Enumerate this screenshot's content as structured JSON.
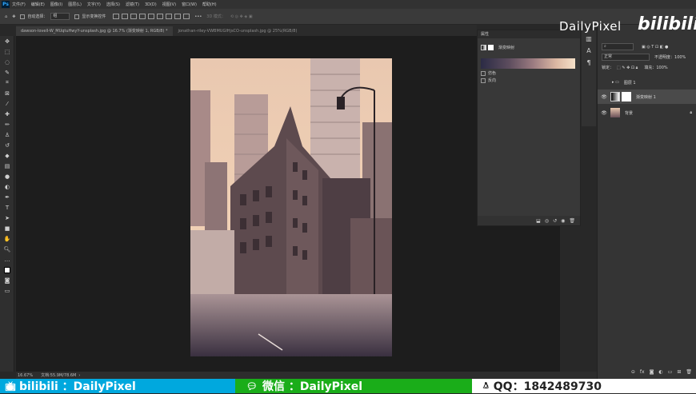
{
  "app": {
    "ps_logo": "Ps"
  },
  "menu": [
    "文件(F)",
    "编辑(E)",
    "图像(I)",
    "图层(L)",
    "文字(Y)",
    "选择(S)",
    "滤镜(T)",
    "3D(D)",
    "视图(V)",
    "窗口(W)",
    "帮助(H)"
  ],
  "options": {
    "auto_select_label": "自动选择：",
    "auto_select_value": "组",
    "show_transform_label": "显示变换控件",
    "mode_3d_label": "3D 模式："
  },
  "tabs": [
    {
      "label": "dawson-lovell-W_MUqtuHwyY-unsplash.jpg @ 16.7% (渐变映射 1, RGB/8) *"
    },
    {
      "label": "jonathan-riley-VWBMUGIHjsCO-unsplash.jpg @ 25%(RGB/8)"
    }
  ],
  "status": {
    "zoom": "16.67%",
    "doc": "文档:55.9M/78.6M"
  },
  "properties": {
    "title": "属性",
    "subtitle": "渐变映射",
    "dither_label": "仿色",
    "reverse_label": "反向"
  },
  "brand": {
    "name": "DailyPixel",
    "bili": "bilibili"
  },
  "layers": {
    "blend_mode": "正常",
    "opacity_label": "不透明度：",
    "opacity_value": "100%",
    "lock_label": "锁定：",
    "fill_label": "填充：",
    "fill_value": "100%",
    "items": [
      {
        "name": "图层 1"
      },
      {
        "name": "渐变映射 1"
      },
      {
        "name": "背景"
      }
    ]
  },
  "bottom": {
    "bili": "bilibili ：DailyPixel",
    "wechat": "微信 ：DailyPixel",
    "qq": "QQ：1842489730"
  },
  "colors": {
    "accent_bili": "#00a8de",
    "accent_wechat": "#1aad19",
    "gradient_start": "#2b2b45",
    "gradient_end": "#f5e0c8"
  }
}
